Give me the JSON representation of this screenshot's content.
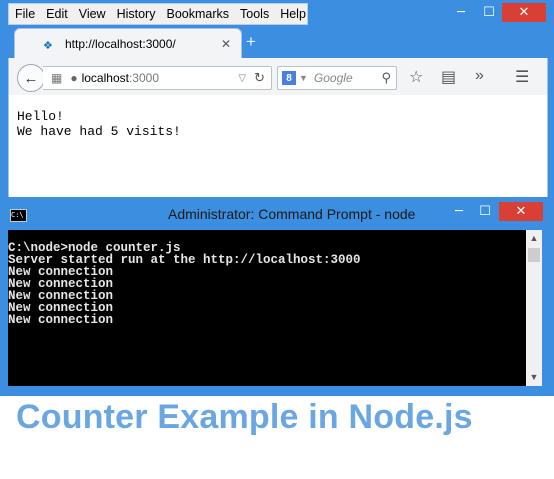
{
  "browser": {
    "menu": [
      "File",
      "Edit",
      "View",
      "History",
      "Bookmarks",
      "Tools",
      "Help"
    ],
    "window_controls": {
      "minimize": "─",
      "maximize": "☐",
      "close": "✕"
    },
    "tab": {
      "title": "http://localhost:3000/",
      "close": "✕"
    },
    "new_tab": "+",
    "url": {
      "host": "localhost",
      "port": ":3000"
    },
    "search": {
      "engine_badge": "8",
      "placeholder": "Google"
    },
    "page_lines": [
      "Hello!",
      "We have had 5 visits!"
    ],
    "icons": [
      "back-arrow-icon",
      "grid-icon",
      "globe-icon",
      "reload-icon",
      "google-icon",
      "magnifier-icon",
      "star-icon",
      "reading-list-icon",
      "overflow-icon",
      "hamburger-menu-icon"
    ]
  },
  "cmd": {
    "title": "Administrator: Command Prompt - node",
    "icon_text": "C:\\",
    "window_controls": {
      "minimize": "─",
      "maximize": "☐",
      "close": "✕"
    },
    "lines": [
      "C:\\node>node counter.js",
      "Server started run at the http://localhost:3000",
      "New connection",
      "New connection",
      "New connection",
      "New connection",
      "New connection"
    ],
    "scroll": {
      "up": "▲",
      "down": "▼"
    }
  },
  "caption": "Counter Example in Node.js",
  "colors": {
    "chrome_blue": "#3c8ee0",
    "close_red": "#d94035",
    "caption": "#6aa7e2"
  }
}
